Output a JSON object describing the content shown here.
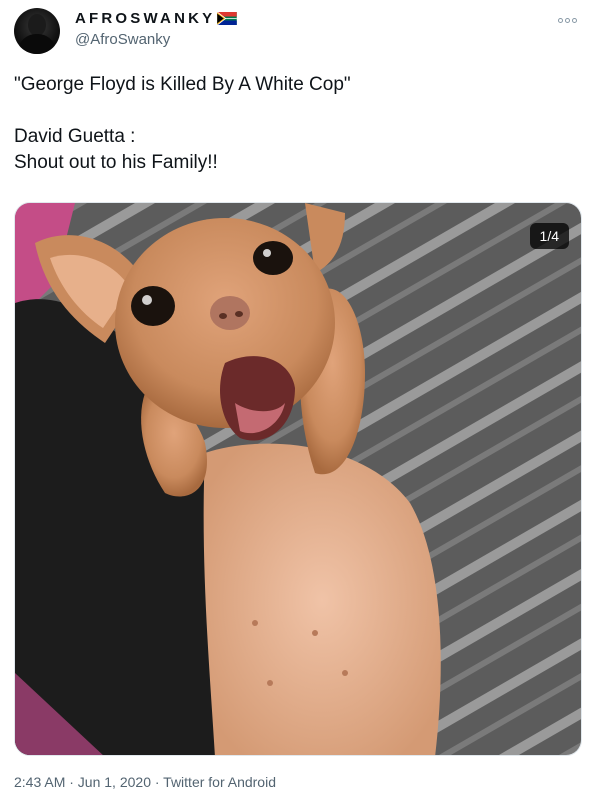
{
  "author": {
    "display_name": "AFROSWANKY",
    "handle": "@AfroSwanky",
    "flag_icon": "south-africa-flag-icon"
  },
  "tweet": {
    "text": "\"George Floyd is Killed By A White Cop\"\n\nDavid Guetta :\nShout out to his Family!!"
  },
  "media": {
    "counter": "1/4"
  },
  "meta": {
    "text": "2:43 AM · Jun 1, 2020 · Twitter for Android"
  },
  "colors": {
    "text": "#0f1419",
    "secondary": "#536471"
  }
}
